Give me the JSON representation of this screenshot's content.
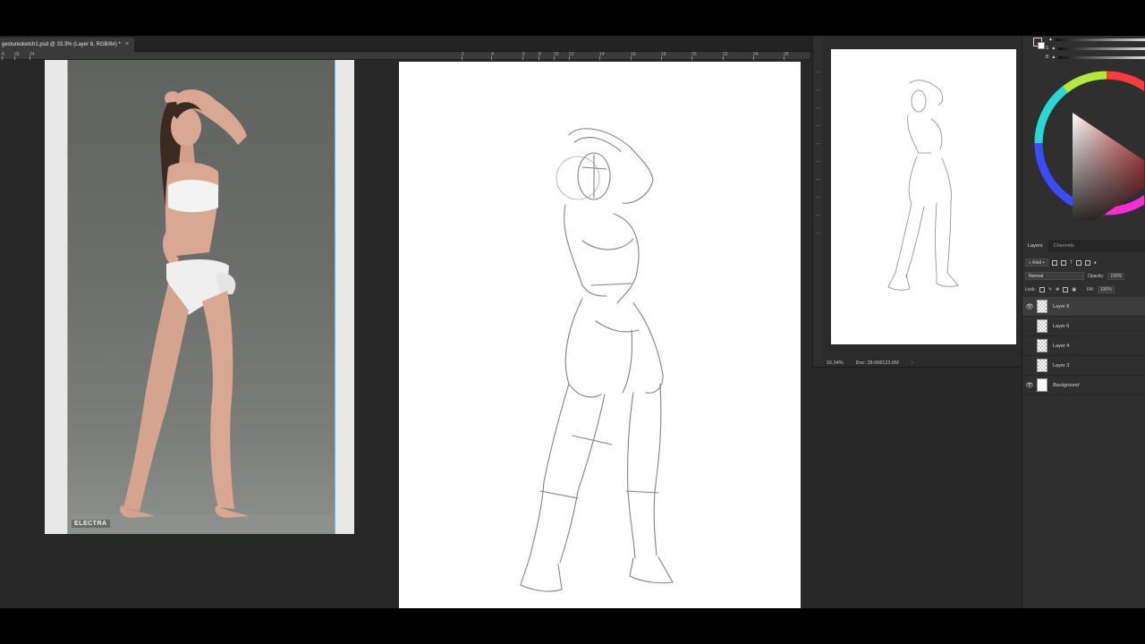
{
  "document": {
    "tab_title": "gesturesketch1.psd @ 33.3% (Layer 8, RGB/8#) *",
    "close_glyph": "×",
    "watermark": "ELECTRA"
  },
  "ruler": {
    "labels": [
      "4",
      "26",
      "24",
      "2",
      "4",
      "6",
      "8",
      "10",
      "12",
      "14",
      "16",
      "18",
      "20",
      "22",
      "24",
      "26"
    ]
  },
  "navigator": {
    "zoom": "15.34%",
    "doc_info": "Doc: 28.6M/123.6M",
    "arrow": "›"
  },
  "color_panel": {
    "foreground_color": "#3b2e33",
    "background_color": "#ffffff",
    "sliders": [
      "",
      "S",
      "B"
    ]
  },
  "layers_panel": {
    "tabs": [
      {
        "label": "Layers",
        "active": true
      },
      {
        "label": "Channels",
        "active": false
      }
    ],
    "filter_label": "Kind",
    "blend_mode": "Normal",
    "opacity_label": "Opacity:",
    "opacity_value": "100%",
    "lock_label": "Lock:",
    "fill_label": "Fill:",
    "fill_value": "100%",
    "layers": [
      {
        "name": "Layer 8",
        "visible": true,
        "selected": true,
        "italic": false
      },
      {
        "name": "Layer 6",
        "visible": false,
        "selected": false,
        "italic": false
      },
      {
        "name": "Layer 4",
        "visible": false,
        "selected": false,
        "italic": false
      },
      {
        "name": "Layer 3",
        "visible": false,
        "selected": false,
        "italic": false
      },
      {
        "name": "Background",
        "visible": true,
        "selected": false,
        "italic": true
      }
    ]
  }
}
